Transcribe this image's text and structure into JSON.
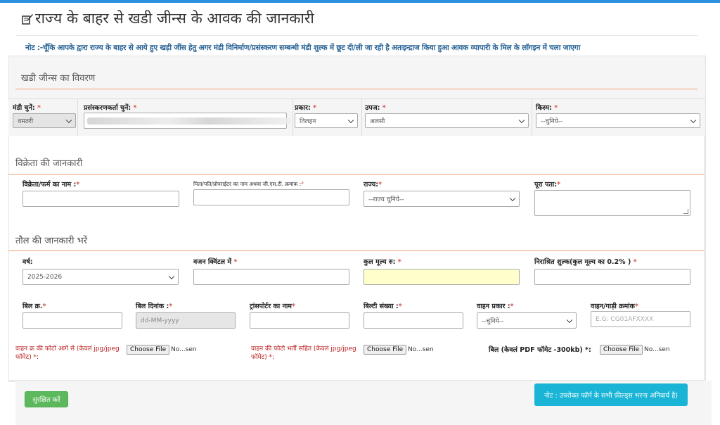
{
  "title": "राज्य के बाहर से खडी जीन्स के आवक की जानकारी",
  "note": "नोट :-चूँकि आपके द्वारा राज्य के बाहर से आये हुए खड़ी जींस हेतु अगर मंडी विनिर्माण/प्रसंस्करण सम्बन्धी मंडी शुल्क में छूट दी/ली जा रही है अतःइन्द्राज किया हुआ आवक व्यापारी के मिल के लॉगइन में चला जाएगा",
  "sections": {
    "goods": "खडी जीन्स का विवरण",
    "seller": "विक्रेता की जानकारी",
    "weight": "तौल की जानकारी भरें"
  },
  "goods": {
    "mandi": {
      "label": "मंडी चुनें:",
      "value": "धमतरी"
    },
    "processor": {
      "label": "प्रसंस्करणकर्ता चुनें:"
    },
    "type": {
      "label": "प्रकार:",
      "value": "तिलहन"
    },
    "crop": {
      "label": "उपज:",
      "value": "अलसी"
    },
    "variety": {
      "label": "किस्म:",
      "value": "--चुनिये--"
    }
  },
  "seller": {
    "name_label": "विक्रेता/फर्म का नाम :",
    "father_label": "पिता/पति/प्रोपराईटर का नाम अथवा जी.एस.टी. क्रमांक :",
    "state_label": "राज्य:",
    "state_value": "--राज्य चुनिये--",
    "address_label": "पूरा पता:"
  },
  "weight": {
    "year_label": "वर्ष:",
    "year_value": "2025-2026",
    "qty_label": "वजन क्विंटल में",
    "value_label": "कुल मूल्य रु:",
    "fee_label": "निराश्रित शुल्क(कुल मूल्य का 0.2% )",
    "bill_no_label": "बिल क्र.",
    "bill_date_label": "बिल दिनांक :",
    "bill_date_placeholder": "dd-MM-yyyy",
    "transporter_label": "ट्रांसपोर्टर का नाम",
    "bilty_label": "बिल्टी संख्या :",
    "vehicle_type_label": "वाहन प्रकार :",
    "vehicle_type_value": "--चुनिये--",
    "vehicle_no_label": "वाहन/गाड़ी क्रमांक",
    "vehicle_no_placeholder": "E.G: CG01AFXXXX"
  },
  "files": {
    "front_label": "वाहन क्र की फोटो आगे से (केवलं jpg/jpeg फॉमेट) *:",
    "loaded_label": "वाहन की फोटो भर्ती सहित (केवलं jpg/jpeg फॉमेट) *:",
    "bill_label": "बिल (केवलं PDF फॉमेट -300kb) *:",
    "button": "Choose File",
    "none": "No...sen"
  },
  "req": "*",
  "save_button": "सुरक्षित करें",
  "bottom_note": "नोट : उपरोक्त फॉर्म के सभी फ़ील्ड्स भरना अनिवार्य है)"
}
